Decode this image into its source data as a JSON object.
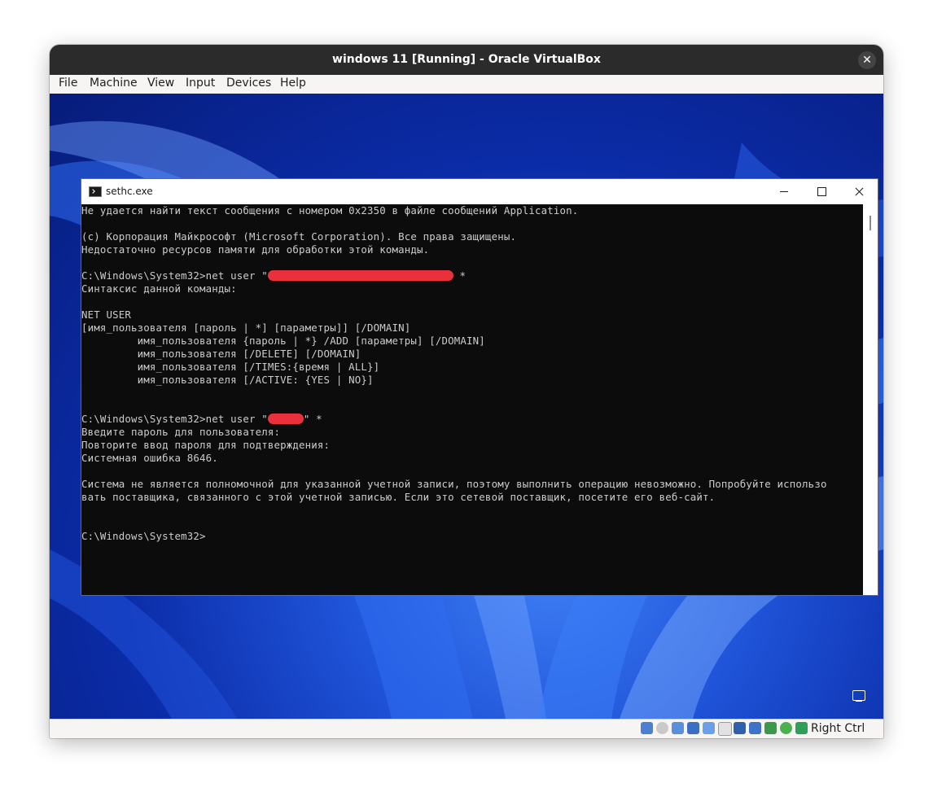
{
  "vbox": {
    "title": "windows 11 [Running] - Oracle VirtualBox",
    "close_glyph": "✕",
    "menu": [
      "File",
      "Machine",
      "View",
      "Input",
      "Devices",
      "Help"
    ],
    "host_key": "Right Ctrl",
    "status_icons": [
      "hard-disk-icon",
      "optical-drive-icon",
      "audio-icon",
      "network-icon",
      "usb-icon",
      "shared-folders-icon",
      "display-icon",
      "video-capture-icon",
      "cpu-icon",
      "mouse-integration-icon",
      "keyboard-icon"
    ]
  },
  "console": {
    "title": "sethc.exe",
    "lines": [
      {
        "text": "Не удается найти текст сообщения с номером 0x2350 в файле сообщений Application."
      },
      {
        "text": ""
      },
      {
        "text": "(c) Корпорация Майкрософт (Microsoft Corporation). Все права защищены."
      },
      {
        "text": "Недостаточно ресурсов памяти для обработки этой команды."
      },
      {
        "text": ""
      },
      {
        "text": "C:\\Windows\\System32>net user \"",
        "redacted": true,
        "tail": " *"
      },
      {
        "text": "Синтаксис данной команды:"
      },
      {
        "text": ""
      },
      {
        "text": "NET USER"
      },
      {
        "text": "[имя_пользователя [пароль | *] [параметры]] [/DOMAIN]"
      },
      {
        "text": "         имя_пользователя {пароль | *} /ADD [параметры] [/DOMAIN]"
      },
      {
        "text": "         имя_пользователя [/DELETE] [/DOMAIN]"
      },
      {
        "text": "         имя_пользователя [/TIMES:{время | ALL}]"
      },
      {
        "text": "         имя_пользователя [/ACTIVE: {YES | NO}]"
      },
      {
        "text": ""
      },
      {
        "text": ""
      },
      {
        "text": "C:\\Windows\\System32>net user \"",
        "redacted": true,
        "tail": "\" *"
      },
      {
        "text": "Введите пароль для пользователя:"
      },
      {
        "text": "Повторите ввод пароля для подтверждения:"
      },
      {
        "text": "Системная ошибка 8646."
      },
      {
        "text": ""
      },
      {
        "text": "Система не является полномочной для указанной учетной записи, поэтому выполнить операцию невозможно. Попробуйте использо"
      },
      {
        "text": "вать поставщика, связанного с этой учетной записью. Если это сетевой поставщик, посетите его веб-сайт."
      },
      {
        "text": ""
      },
      {
        "text": ""
      },
      {
        "text": "C:\\Windows\\System32>"
      }
    ]
  }
}
